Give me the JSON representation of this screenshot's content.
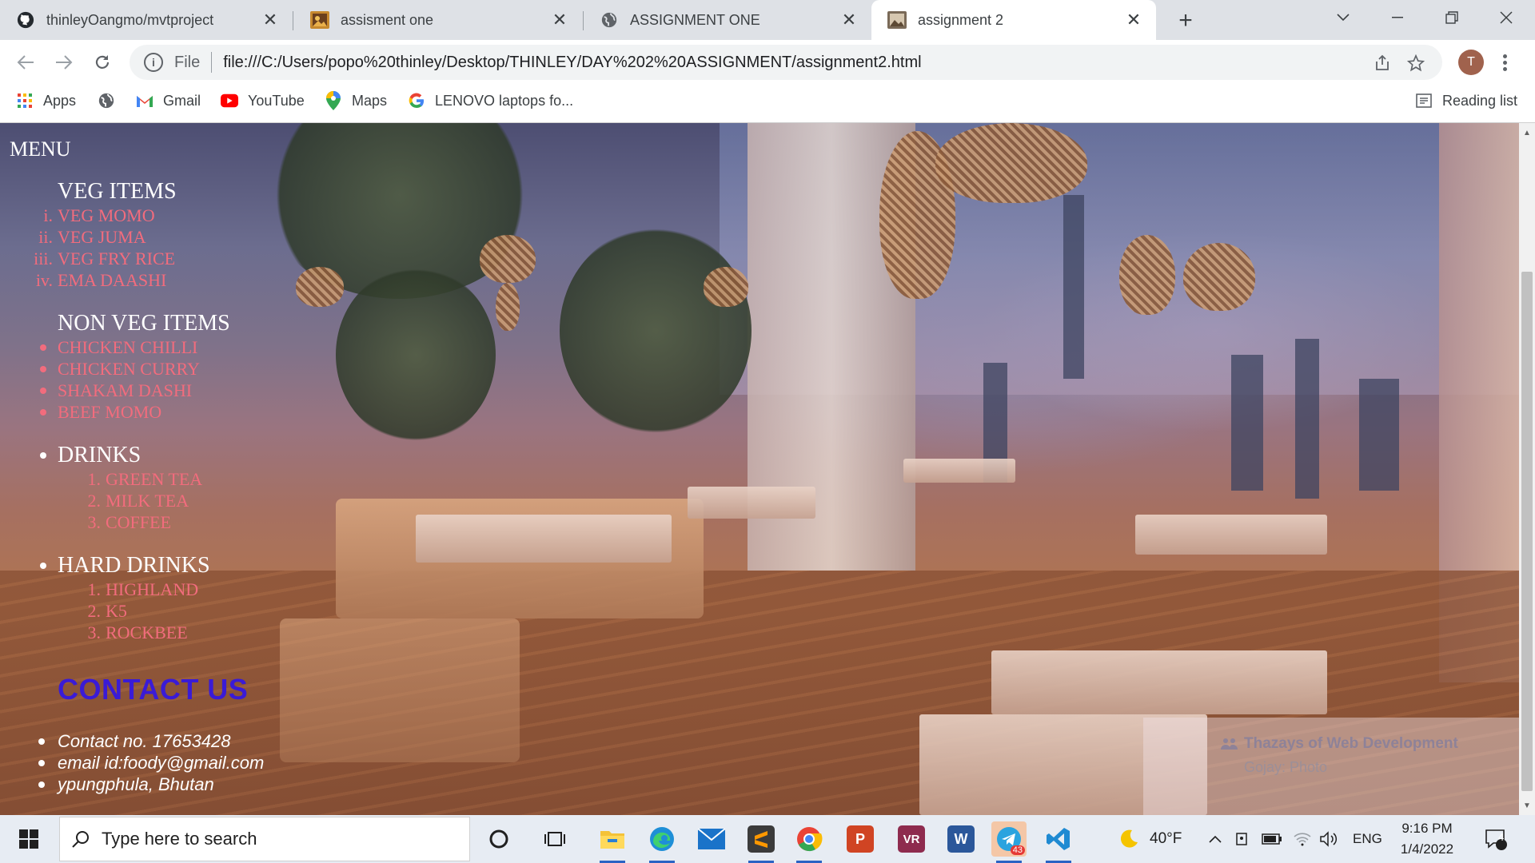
{
  "browser": {
    "tabs": [
      {
        "title": "thinleyOangmo/mvtproject",
        "icon": "github-icon",
        "active": false
      },
      {
        "title": "assisment one",
        "icon": "image-favicon-icon",
        "active": false
      },
      {
        "title": "ASSIGNMENT ONE",
        "icon": "globe-icon",
        "active": false
      },
      {
        "title": "assignment 2",
        "icon": "image-favicon-icon",
        "active": true
      }
    ],
    "address": {
      "scheme_label": "File",
      "url": "file:///C:/Users/popo%20thinley/Desktop/THINLEY/DAY%202%20ASSIGNMENT/assignment2.html"
    },
    "profile_initial": "T",
    "bookmarks": [
      {
        "label": "Apps",
        "icon": "apps-grid-icon"
      },
      {
        "label": "",
        "icon": "globe-icon"
      },
      {
        "label": "Gmail",
        "icon": "gmail-icon"
      },
      {
        "label": "YouTube",
        "icon": "youtube-icon"
      },
      {
        "label": "Maps",
        "icon": "maps-pin-icon"
      },
      {
        "label": "LENOVO laptops fo...",
        "icon": "google-icon"
      }
    ],
    "reading_list": "Reading list"
  },
  "page": {
    "menu_heading": "MENU",
    "sections": [
      {
        "title": "VEG ITEMS",
        "list_style": "lower-roman",
        "items": [
          {
            "marker": "i.",
            "label": "VEG MOMO"
          },
          {
            "marker": "ii.",
            "label": "VEG JUMA"
          },
          {
            "marker": "iii.",
            "label": "VEG FRY RICE"
          },
          {
            "marker": "iv.",
            "label": "EMA DAASHI"
          }
        ]
      },
      {
        "title": "NON VEG ITEMS",
        "list_style": "disc",
        "items": [
          {
            "label": "CHICKEN CHILLI"
          },
          {
            "label": "CHICKEN CURRY"
          },
          {
            "label": "SHAKAM DASHI"
          },
          {
            "label": "BEEF MOMO"
          }
        ]
      },
      {
        "title": "DRINKS",
        "list_style": "decimal",
        "items": [
          {
            "marker": "1.",
            "label": "GREEN TEA"
          },
          {
            "marker": "2.",
            "label": "MILK TEA"
          },
          {
            "marker": "3.",
            "label": "COFFEE"
          }
        ]
      },
      {
        "title": "HARD DRINKS",
        "list_style": "decimal",
        "items": [
          {
            "marker": "1.",
            "label": "HIGHLAND"
          },
          {
            "marker": "2.",
            "label": "K5"
          },
          {
            "marker": "3.",
            "label": "ROCKBEE"
          }
        ]
      }
    ],
    "contact_heading": "CONTACT US",
    "contact_items": [
      "Contact no. 17653428",
      "email id:foody@gmail.com",
      "ypungphula, Bhutan"
    ],
    "overlay_notice": {
      "title": "Thazays of Web Development",
      "subtitle": "Gojay: Photo"
    },
    "colors": {
      "item_text": "#f26c7d",
      "heading_text": "#ffffff",
      "contact_heading": "#3a1bd6"
    }
  },
  "taskbar": {
    "search_placeholder": "Type here to search",
    "apps": [
      "cortana-icon",
      "task-view-icon",
      "file-explorer-icon",
      "edge-icon",
      "mail-icon",
      "sublime-text-icon",
      "chrome-icon",
      "powerpoint-icon",
      "winrar-icon",
      "word-icon",
      "telegram-icon",
      "vscode-icon"
    ],
    "telegram_badge": "43",
    "weather": "40°F",
    "language": "ENG",
    "time": "9:16 PM",
    "date": "1/4/2022",
    "notification_count": "4"
  }
}
